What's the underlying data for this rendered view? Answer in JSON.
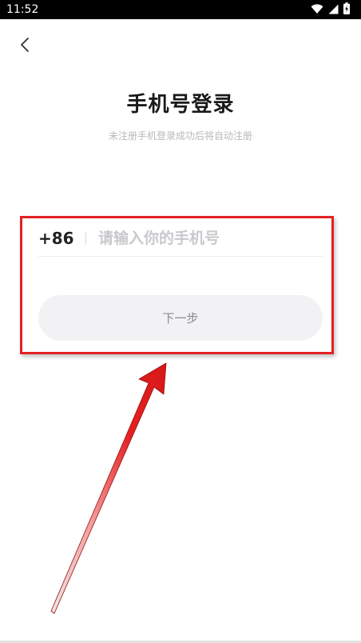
{
  "status_bar": {
    "time": "11:52",
    "icons": [
      "wifi-icon",
      "cellular-signal-icon",
      "battery-icon"
    ]
  },
  "header": {
    "back_icon": "chevron-left-icon"
  },
  "login": {
    "title": "手机号登录",
    "subtitle": "未注册手机登录成功后将自动注册",
    "country_code": "+86",
    "phone_placeholder": "请输入你的手机号",
    "phone_value": "",
    "next_label": "下一步"
  },
  "annotation": {
    "highlight_color": "#e32121",
    "arrow_color": "#e32121"
  },
  "colors": {
    "title": "#1a1a1a",
    "subtitle": "#b8b8bd",
    "placeholder": "#c9c9ce",
    "button_bg": "#f2f2f4",
    "button_text": "#8a8a8f"
  }
}
